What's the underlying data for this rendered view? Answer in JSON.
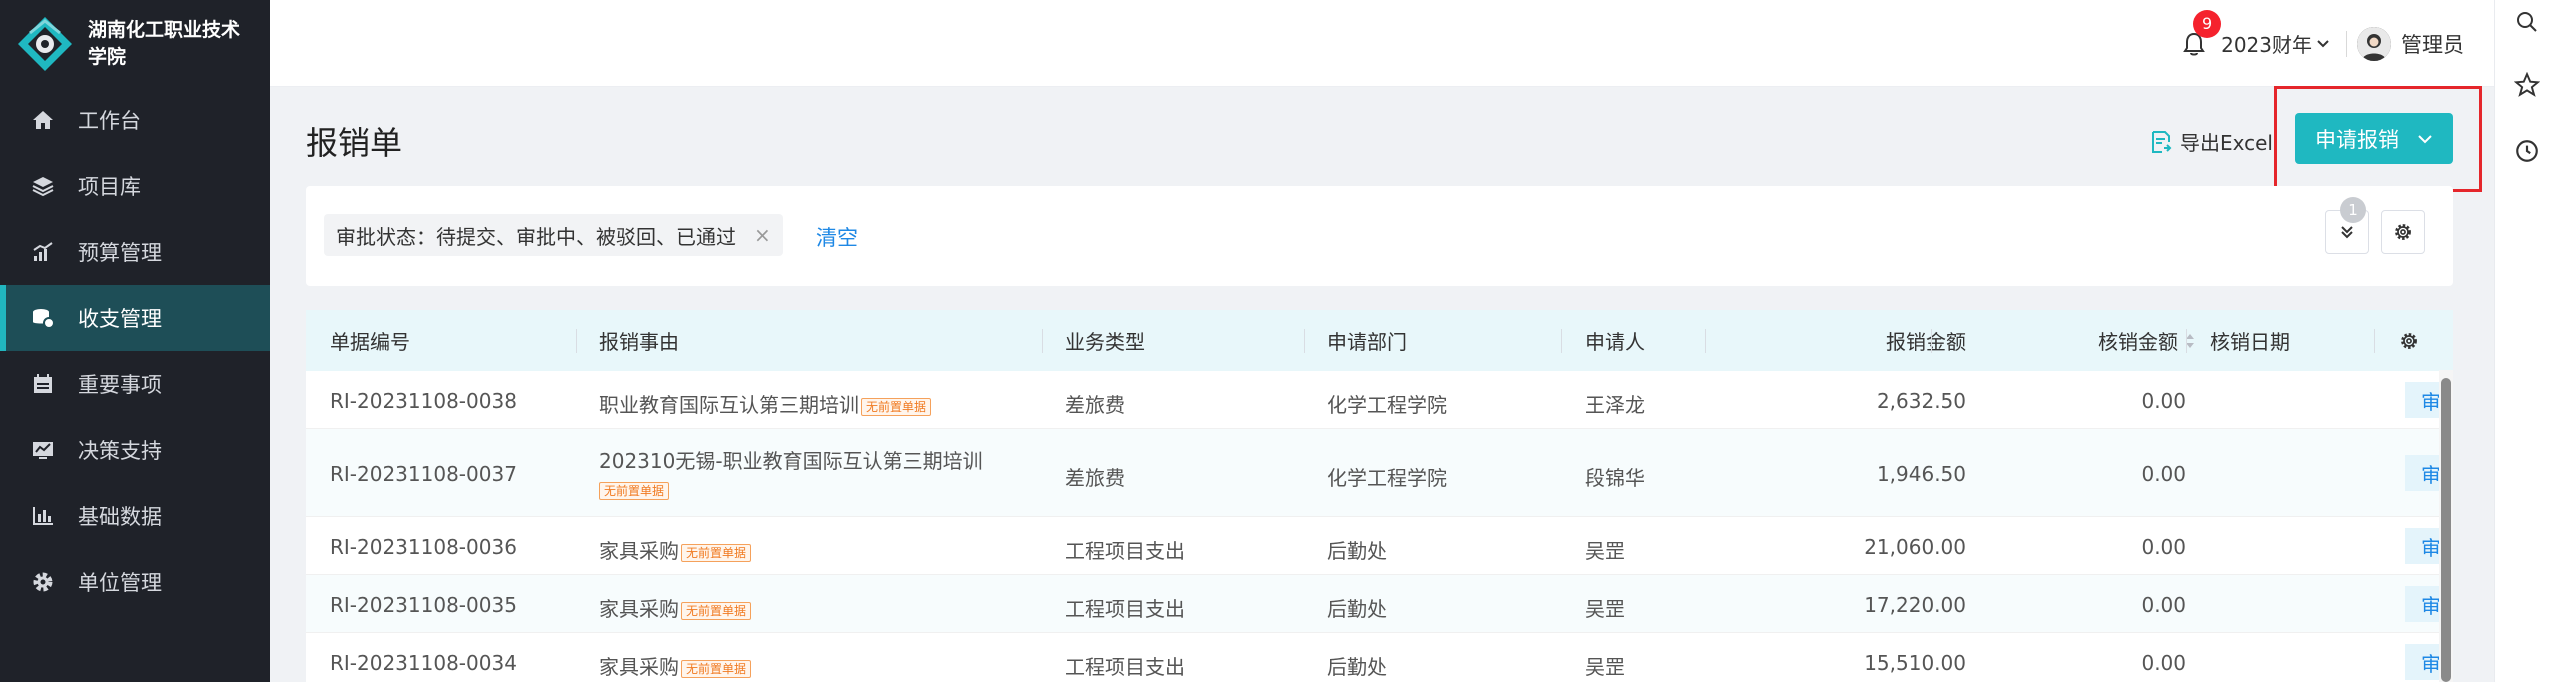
{
  "brand": {
    "name": "湖南化工职业技术学院"
  },
  "sidebar": {
    "items": [
      {
        "label": "工作台",
        "icon": "home-icon"
      },
      {
        "label": "项目库",
        "icon": "layers-icon"
      },
      {
        "label": "预算管理",
        "icon": "chart-icon"
      },
      {
        "label": "收支管理",
        "icon": "coins-icon",
        "active": true
      },
      {
        "label": "重要事项",
        "icon": "calendar-icon"
      },
      {
        "label": "决策支持",
        "icon": "decision-icon"
      },
      {
        "label": "基础数据",
        "icon": "bar-chart-icon"
      },
      {
        "label": "单位管理",
        "icon": "gear-icon"
      }
    ]
  },
  "header": {
    "notification_count": "9",
    "fiscal_year": "2023财年",
    "user_name": "管理员"
  },
  "page": {
    "title": "报销单",
    "export_label": "导出Excel",
    "apply_label": "申请报销"
  },
  "filter": {
    "tag": "审批状态：待提交、审批中、被驳回、已通过",
    "clear_label": "清空",
    "filter_count": "1"
  },
  "table": {
    "columns": [
      "单据编号",
      "报销事由",
      "业务类型",
      "申请部门",
      "申请人",
      "报销金额",
      "核销金额",
      "核销日期"
    ],
    "tag_label": "无前置单据",
    "op_label": "审",
    "rows": [
      {
        "no": "RI-20231108-0038",
        "reason": "职业教育国际互认第三期培训",
        "type": "差旅费",
        "dept": "化学工程学院",
        "person": "王泽龙",
        "amount": "2,632.50",
        "verify": "0.00"
      },
      {
        "no": "RI-20231108-0037",
        "reason": "202310无锡-职业教育国际互认第三期培训",
        "type": "差旅费",
        "dept": "化学工程学院",
        "person": "段锦华",
        "amount": "1,946.50",
        "verify": "0.00"
      },
      {
        "no": "RI-20231108-0036",
        "reason": "家具采购",
        "type": "工程项目支出",
        "dept": "后勤处",
        "person": "吴罡",
        "amount": "21,060.00",
        "verify": "0.00"
      },
      {
        "no": "RI-20231108-0035",
        "reason": "家具采购",
        "type": "工程项目支出",
        "dept": "后勤处",
        "person": "吴罡",
        "amount": "17,220.00",
        "verify": "0.00"
      },
      {
        "no": "RI-20231108-0034",
        "reason": "家具采购",
        "type": "工程项目支出",
        "dept": "后勤处",
        "person": "吴罡",
        "amount": "15,510.00",
        "verify": "0.00"
      }
    ]
  },
  "colors": {
    "accent": "#1fb8c1",
    "sidebar_bg": "#1f2229",
    "active_bg": "#1e4e57",
    "highlight_border": "#e5262b",
    "link": "#1e88e5"
  }
}
